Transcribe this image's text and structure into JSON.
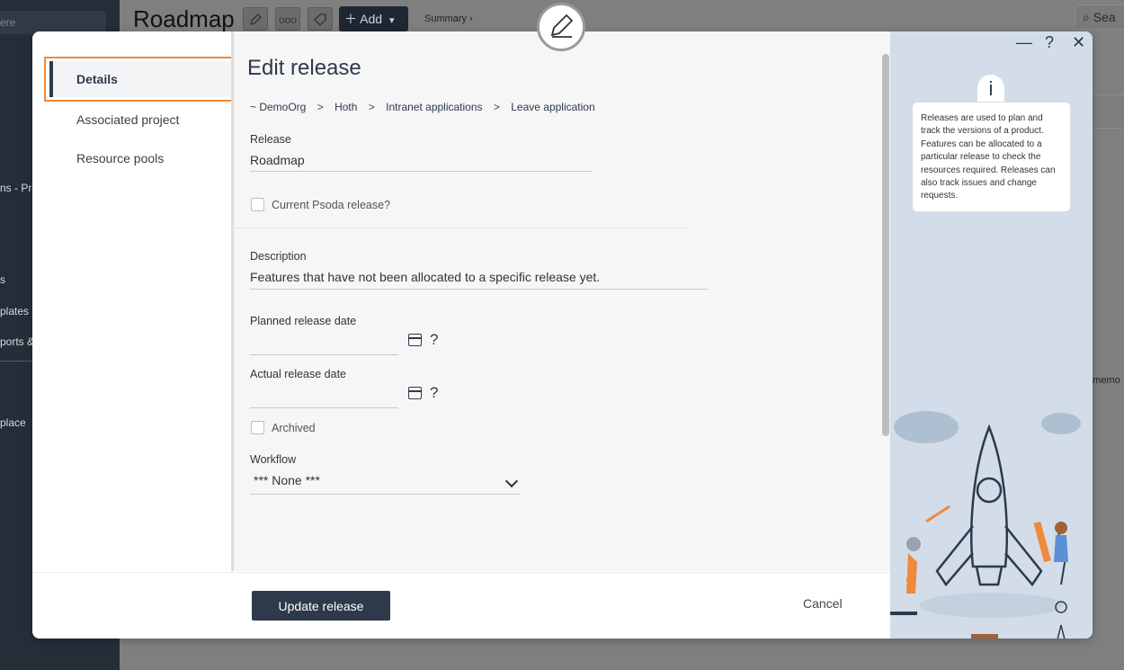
{
  "background": {
    "sidebar": {
      "search_placeholder": "ere",
      "items": [
        "ns - Pro",
        "s",
        "plates",
        "ports &",
        "place"
      ]
    },
    "page_title": "Roadmap",
    "toolbar": {
      "more_label": "ooo",
      "add_label": "Add"
    },
    "summary_label": "Summary ›",
    "search_label": "Sea",
    "memo_label": "' memo"
  },
  "modal": {
    "nav": {
      "items": [
        "Details",
        "Associated project",
        "Resource pools"
      ],
      "active": "Details"
    },
    "title": "Edit release",
    "breadcrumb": [
      "~ DemoOrg",
      "Hoth",
      "Intranet applications",
      "Leave application"
    ],
    "breadcrumb_separator": ">",
    "form": {
      "release_label": "Release",
      "release_value": "Roadmap",
      "current_label": "Current Psoda release?",
      "description_label": "Description",
      "description_value": "Features that have not been allocated to a specific release yet.",
      "planned_label": "Planned release date",
      "planned_value": "",
      "actual_label": "Actual release date",
      "actual_value": "",
      "help_mark": "?",
      "archived_label": "Archived",
      "workflow_label": "Workflow",
      "workflow_value": "*** None ***"
    },
    "footer": {
      "update_label": "Update release",
      "cancel_label": "Cancel"
    },
    "window_controls": {
      "minimize": "—",
      "help": "?",
      "close": "✕"
    },
    "info": {
      "icon": "i",
      "text": "Releases are used to plan and track the versions of a product. Features can be allocated to a particular release to check the resources required. Releases can also track issues and change requests."
    }
  },
  "colors": {
    "accent": "#2e3a4b",
    "highlight": "#f0893a",
    "panel": "#d2dde9",
    "sidebar": "#252d38"
  }
}
